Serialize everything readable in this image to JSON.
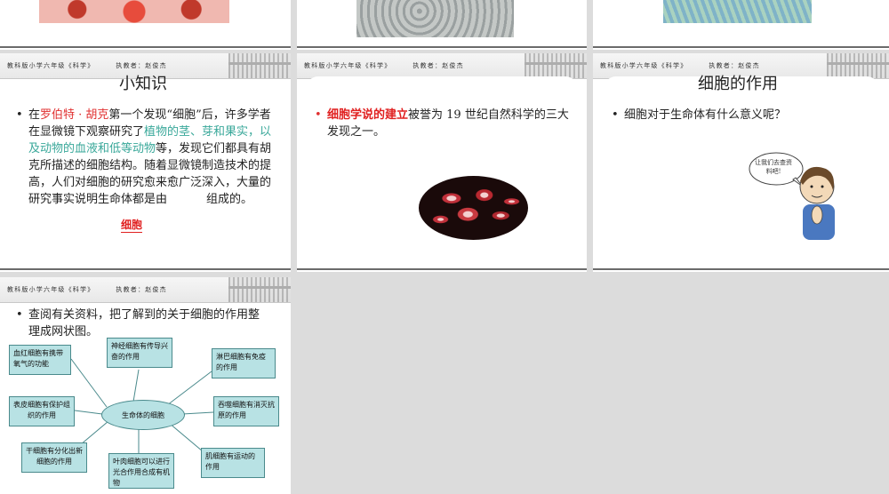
{
  "banner": {
    "publisher": "教科版小学六年级《科学》",
    "teacher": "执教者：赵俊杰"
  },
  "slide_know": {
    "title": "小知识",
    "bullet": "•",
    "t1": "在",
    "red1": "罗伯特 · 胡克",
    "t2": "第一个发现“细胞”后，许多学者在显微镜下观察研究了",
    "teal1": "植物的茎、芽和果实，以及动物的血液和低等动物",
    "t3": "等，发现它们都具有胡克所描述的细胞结构。随着显微镜制造技术的提高，人们对细胞的研究愈来愈广泛深入，大量的研究事实说明生命体都是由",
    "t4": "组成的。",
    "answer": "细胞"
  },
  "slide_theory": {
    "bullet": "•",
    "red": "细胞学说的建立",
    "rest": "被誉为 19 世纪自然科学的三大发现之一。"
  },
  "slide_role": {
    "title": "细胞的作用",
    "bullet": "•",
    "text": "细胞对于生命体有什么意义呢？",
    "bubble": "让我们去查资料吧!"
  },
  "slide_map": {
    "bullet": "•",
    "text": "查阅有关资料，把了解到的关于细胞的作用整理成网状图。",
    "center": "生命体的细胞",
    "nodes": {
      "red_blood": "血红细胞有携带氧气的功能",
      "nerve": "神经细胞有传导兴奋的作用",
      "lymph": "淋巴细胞有免疫的作用",
      "skin": "表皮细胞有保护组织的作用",
      "phago": "吞噬细胞有消灭抗原的作用",
      "stem": "干细胞有分化出新细胞的作用",
      "leaf": "叶肉细胞可以进行光合作用合成有机物",
      "muscle": "肌细胞有运动的作用"
    }
  },
  "colors": {
    "red": "#e03030",
    "teal": "#3aa89a",
    "node_fill": "#b8e2e4"
  }
}
